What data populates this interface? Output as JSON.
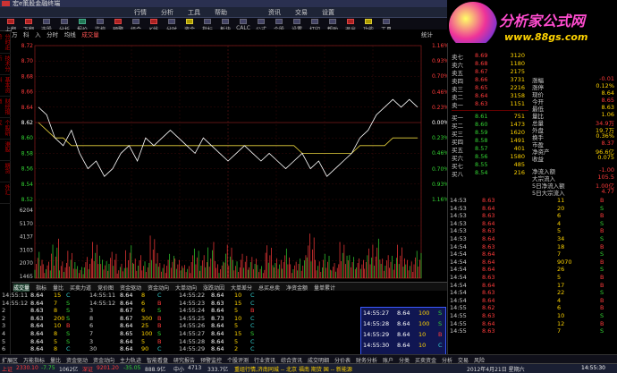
{
  "app": {
    "title": "宏e策股金融终端"
  },
  "brand": {
    "name": "分析家公式网",
    "url": "www.88gs.com"
  },
  "menu": [
    "行情",
    "分析",
    "工具",
    "帮助",
    "资讯",
    "交易",
    "设置"
  ],
  "toolbar": [
    "上翻",
    "下翻",
    "选股",
    "分析",
    "报价",
    "监控",
    "预警",
    "组合",
    "K线",
    "分时",
    "资金",
    "指标",
    "板块",
    "CALC",
    "公式",
    "个股",
    "设置",
    "打印",
    "帮助",
    "退出",
    "功能",
    "工具"
  ],
  "sidebar": [
    "分时走势",
    "技术分析",
    "基本资料",
    "财经报道",
    "个股研究",
    "港股",
    "期货",
    "外汇"
  ],
  "chartbar": {
    "tabs": [
      "万",
      "科",
      "入",
      "分时",
      "均线",
      "成交量"
    ],
    "active": "成交量",
    "stat": "统计"
  },
  "price_axis": [
    "8.72",
    "8.70",
    "8.68",
    "8.66",
    "8.64",
    "8.62",
    "8.60",
    "8.58",
    "8.56",
    "8.54",
    "8.52"
  ],
  "pct_axis": [
    "1.16%",
    "0.93%",
    "0.70%",
    "0.46%",
    "0.23%",
    "0.00%",
    "0.23%",
    "0.46%",
    "0.70%",
    "0.93%",
    "1.16%"
  ],
  "vol_axis": [
    "12411",
    "10253",
    "9310",
    "8278",
    "7238",
    "6204",
    "5170",
    "4137",
    "3103",
    "2070",
    "1465"
  ],
  "price_line": [
    8.64,
    8.63,
    8.6,
    8.59,
    8.61,
    8.58,
    8.56,
    8.57,
    8.55,
    8.56,
    8.58,
    8.59,
    8.57,
    8.6,
    8.59,
    8.6,
    8.61,
    8.6,
    8.59,
    8.58,
    8.6,
    8.59,
    8.58,
    8.57,
    8.58,
    8.59,
    8.58,
    8.57,
    8.58,
    8.57,
    8.56,
    8.57,
    8.58,
    8.56,
    8.57,
    8.55,
    8.56,
    8.57,
    8.58,
    8.6,
    8.61,
    8.63,
    8.64,
    8.65,
    8.64,
    8.65,
    8.64
  ],
  "avg_line": [
    8.62,
    8.61,
    8.6,
    8.6,
    8.59,
    8.59,
    8.59,
    8.59,
    8.59,
    8.59,
    8.59,
    8.59,
    8.59,
    8.59,
    8.59,
    8.59,
    8.59,
    8.59,
    8.59,
    8.59,
    8.59,
    8.59,
    8.59,
    8.59,
    8.59,
    8.59,
    8.59,
    8.59,
    8.59,
    8.59,
    8.59,
    8.59,
    8.58,
    8.58,
    8.58,
    8.58,
    8.58,
    8.58,
    8.58,
    8.59,
    8.59,
    8.59,
    8.59,
    8.6,
    8.6,
    8.6,
    8.6
  ],
  "volumes": [
    40,
    25,
    60,
    30,
    45,
    20,
    35,
    55,
    28,
    40,
    22,
    50,
    35,
    30,
    70,
    25,
    40,
    30,
    20,
    45,
    35,
    55,
    25,
    60,
    30,
    40,
    35,
    20,
    50,
    30,
    45,
    25,
    35,
    80,
    30,
    40,
    25,
    55,
    35,
    30,
    45,
    60,
    35,
    40,
    55,
    30,
    45
  ],
  "orderbook": {
    "asks": [
      {
        "label": "卖七",
        "price": "8.69",
        "vol": "3120"
      },
      {
        "label": "卖六",
        "price": "8.68",
        "vol": "1180"
      },
      {
        "label": "卖五",
        "price": "8.67",
        "vol": "2175"
      },
      {
        "label": "卖四",
        "price": "8.66",
        "vol": "3731"
      },
      {
        "label": "卖三",
        "price": "8.65",
        "vol": "2216"
      },
      {
        "label": "卖二",
        "price": "8.64",
        "vol": "3158"
      },
      {
        "label": "卖一",
        "price": "8.63",
        "vol": "1151"
      }
    ],
    "bids": [
      {
        "label": "买一",
        "price": "8.61",
        "vol": "751"
      },
      {
        "label": "买二",
        "price": "8.60",
        "vol": "1473"
      },
      {
        "label": "买三",
        "price": "8.59",
        "vol": "1620"
      },
      {
        "label": "买四",
        "price": "8.58",
        "vol": "1491"
      },
      {
        "label": "买五",
        "price": "8.57",
        "vol": "401"
      },
      {
        "label": "买六",
        "price": "8.56",
        "vol": "1580"
      },
      {
        "label": "买七",
        "price": "8.55",
        "vol": "485"
      },
      {
        "label": "买八",
        "price": "8.54",
        "vol": "216"
      }
    ]
  },
  "info": [
    {
      "l": "涨幅",
      "v": "-0.01"
    },
    {
      "l": "涨停",
      "v": "0.12%"
    },
    {
      "l": "现价",
      "v": "8.64"
    },
    {
      "l": "今开",
      "v": "8.65"
    },
    {
      "l": "最低",
      "v": "8.63"
    },
    {
      "l": "量比",
      "v": "1.06"
    },
    {
      "l": "总量",
      "v": "34.9万"
    },
    {
      "l": "外盘",
      "v": "19.7万"
    },
    {
      "l": "换手",
      "v": "0.36%"
    },
    {
      "l": "市盈",
      "v": "8.37"
    },
    {
      "l": "净资产",
      "v": "96.6亿"
    },
    {
      "l": "收益",
      "v": "0.075"
    }
  ],
  "flow": [
    {
      "l": "净流入额",
      "v": "-1.00"
    },
    {
      "l": "大宗流入",
      "v": "105.5"
    },
    {
      "l": "5日净流入额",
      "v": "1.00亿"
    },
    {
      "l": "5日大宗流入",
      "v": "4.77"
    }
  ],
  "ticks": [
    {
      "t": "14:53",
      "p": "8.63",
      "v": "11",
      "s": "B"
    },
    {
      "t": "14:53",
      "p": "8.64",
      "v": "20",
      "s": "S"
    },
    {
      "t": "14:53",
      "p": "8.63",
      "v": "6",
      "s": "B"
    },
    {
      "t": "14:53",
      "p": "8.64",
      "v": "4",
      "s": "S"
    },
    {
      "t": "14:53",
      "p": "8.63",
      "v": "5",
      "s": "B"
    },
    {
      "t": "14:53",
      "p": "8.64",
      "v": "34",
      "s": "S"
    },
    {
      "t": "14:54",
      "p": "8.63",
      "v": "18",
      "s": "B"
    },
    {
      "t": "14:54",
      "p": "8.64",
      "v": "7",
      "s": "S"
    },
    {
      "t": "14:54",
      "p": "8.64",
      "v": "9070",
      "s": "B"
    },
    {
      "t": "14:54",
      "p": "8.64",
      "v": "26",
      "s": "S"
    },
    {
      "t": "14:54",
      "p": "8.63",
      "v": "5",
      "s": "B"
    },
    {
      "t": "14:54",
      "p": "8.64",
      "v": "17",
      "s": "B"
    },
    {
      "t": "14:54",
      "p": "8.63",
      "v": "22",
      "s": "S"
    },
    {
      "t": "14:54",
      "p": "8.64",
      "v": "4",
      "s": "B"
    },
    {
      "t": "14:55",
      "p": "8.62",
      "v": "6",
      "s": "B"
    },
    {
      "t": "14:55",
      "p": "8.63",
      "v": "10",
      "s": "S"
    },
    {
      "t": "14:55",
      "p": "8.64",
      "v": "12",
      "s": "B"
    },
    {
      "t": "14:55",
      "p": "8.63",
      "v": "7",
      "s": "S"
    }
  ],
  "bottom_tabs": [
    "成交量",
    "指标",
    "量比",
    "买卖力道",
    "竞价图",
    "资金驱动",
    "资金动向",
    "大单动向",
    "涨跌动因",
    "大单差分",
    "总买总卖",
    "净资金额",
    "量单累计"
  ],
  "trades": [
    [
      "14:55:11",
      "8.64",
      "15",
      "C",
      "14:55:11",
      "8.64",
      "8",
      "C",
      "14:55:22",
      "8.64",
      "10",
      "C"
    ],
    [
      "14:55:12",
      "8.64",
      "7",
      "S",
      "14:55:12",
      "8.64",
      "6",
      "B",
      "14:55:23",
      "8.63",
      "15",
      "C"
    ],
    [
      "2",
      "8.63",
      "8",
      "S",
      "3",
      "8.67",
      "6",
      "S",
      "14:55:24",
      "8.64",
      "5",
      "B"
    ],
    [
      "2",
      "8.63",
      "200",
      "S",
      "8",
      "8.67",
      "300",
      "B",
      "14:55:25",
      "8.73",
      "10",
      "C"
    ],
    [
      "3",
      "8.64",
      "10",
      "B",
      "6",
      "8.64",
      "25",
      "B",
      "14:55:26",
      "8.64",
      "5",
      "C"
    ],
    [
      "4",
      "8.64",
      "8",
      "S",
      "7",
      "8.65",
      "100",
      "S",
      "14:55:27",
      "8.64",
      "15",
      "S"
    ],
    [
      "5",
      "8.64",
      "5",
      "S",
      "3",
      "8.64",
      "5",
      "B",
      "14:55:28",
      "8.64",
      "5",
      "C"
    ],
    [
      "6",
      "8.64",
      "8",
      "C",
      "30",
      "8.64",
      "90",
      "C",
      "14:55:29",
      "8.64",
      "2",
      "C"
    ]
  ],
  "highlight_rows": [
    [
      "14:55:27",
      "8.64",
      "100",
      "S"
    ],
    [
      "14:55:28",
      "8.64",
      "100",
      "S"
    ],
    [
      "14:55:29",
      "8.64",
      "10",
      "B"
    ],
    [
      "14:55:30",
      "8.64",
      "10",
      "C"
    ]
  ],
  "bottom_strip": [
    "扩展区",
    "万能指标",
    "量比",
    "资金驱动",
    "资金动向",
    "主力轨迹",
    "智能看盘",
    "研究报告",
    "预警监控",
    "个股评测",
    "行业资讯",
    "综合资讯",
    "成交明细",
    "分价表",
    "财务分析",
    "账户",
    "分类",
    "买卖资金",
    "分析",
    "交易",
    "风险"
  ],
  "status": {
    "sh": "上证",
    "sh_val": "2330.10",
    "sh_chg": "-7.75",
    "sh_amt": "1062亿",
    "sz": "深证",
    "sz_val": "9201.20",
    "sz_chg": "-35.05",
    "sz_amt": "888.9亿",
    "mid": "中小",
    "mid_val": "4713",
    "mid_chg": "333.7亿",
    "news": "重组行情,济南同城 -- 北京 福南 期货 国 -- 新能源",
    "date": "2012年4月21日 星期六",
    "time": "14:55:30"
  },
  "right_bottom": {
    "buy": "买(0)",
    "buy_val": "8.61",
    "buy_vol": "2笔"
  }
}
